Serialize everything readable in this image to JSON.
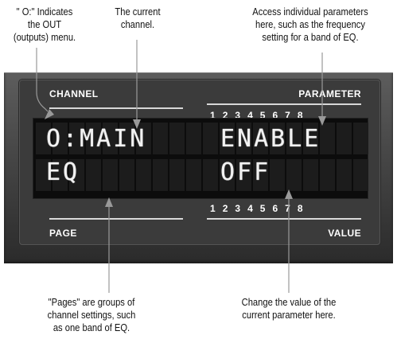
{
  "callouts": {
    "out_menu": [
      "\" O:\" Indicates",
      "the OUT",
      "(outputs) menu."
    ],
    "current_channel": [
      "The current",
      "channel."
    ],
    "parameters": [
      "Access individual parameters",
      "here, such as the frequency",
      "setting for a band of EQ."
    ],
    "pages": [
      "\"Pages\" are groups of",
      "channel settings, such",
      "as one band of EQ."
    ],
    "value": [
      "Change the value of the",
      "current parameter here."
    ]
  },
  "panel": {
    "channel_label": "CHANNEL",
    "parameter_label": "PARAMETER",
    "page_label": "PAGE",
    "value_label": "VALUE",
    "parameter_numbers": [
      "1",
      "2",
      "3",
      "4",
      "5",
      "6",
      "7",
      "8"
    ],
    "value_numbers": [
      "1",
      "2",
      "3",
      "4",
      "5",
      "6",
      "7",
      "8"
    ]
  },
  "lcd": {
    "channel_line": "O:MAIN",
    "page_line": "EQ",
    "parameter_line": "ENABLE",
    "value_line": "OFF"
  }
}
